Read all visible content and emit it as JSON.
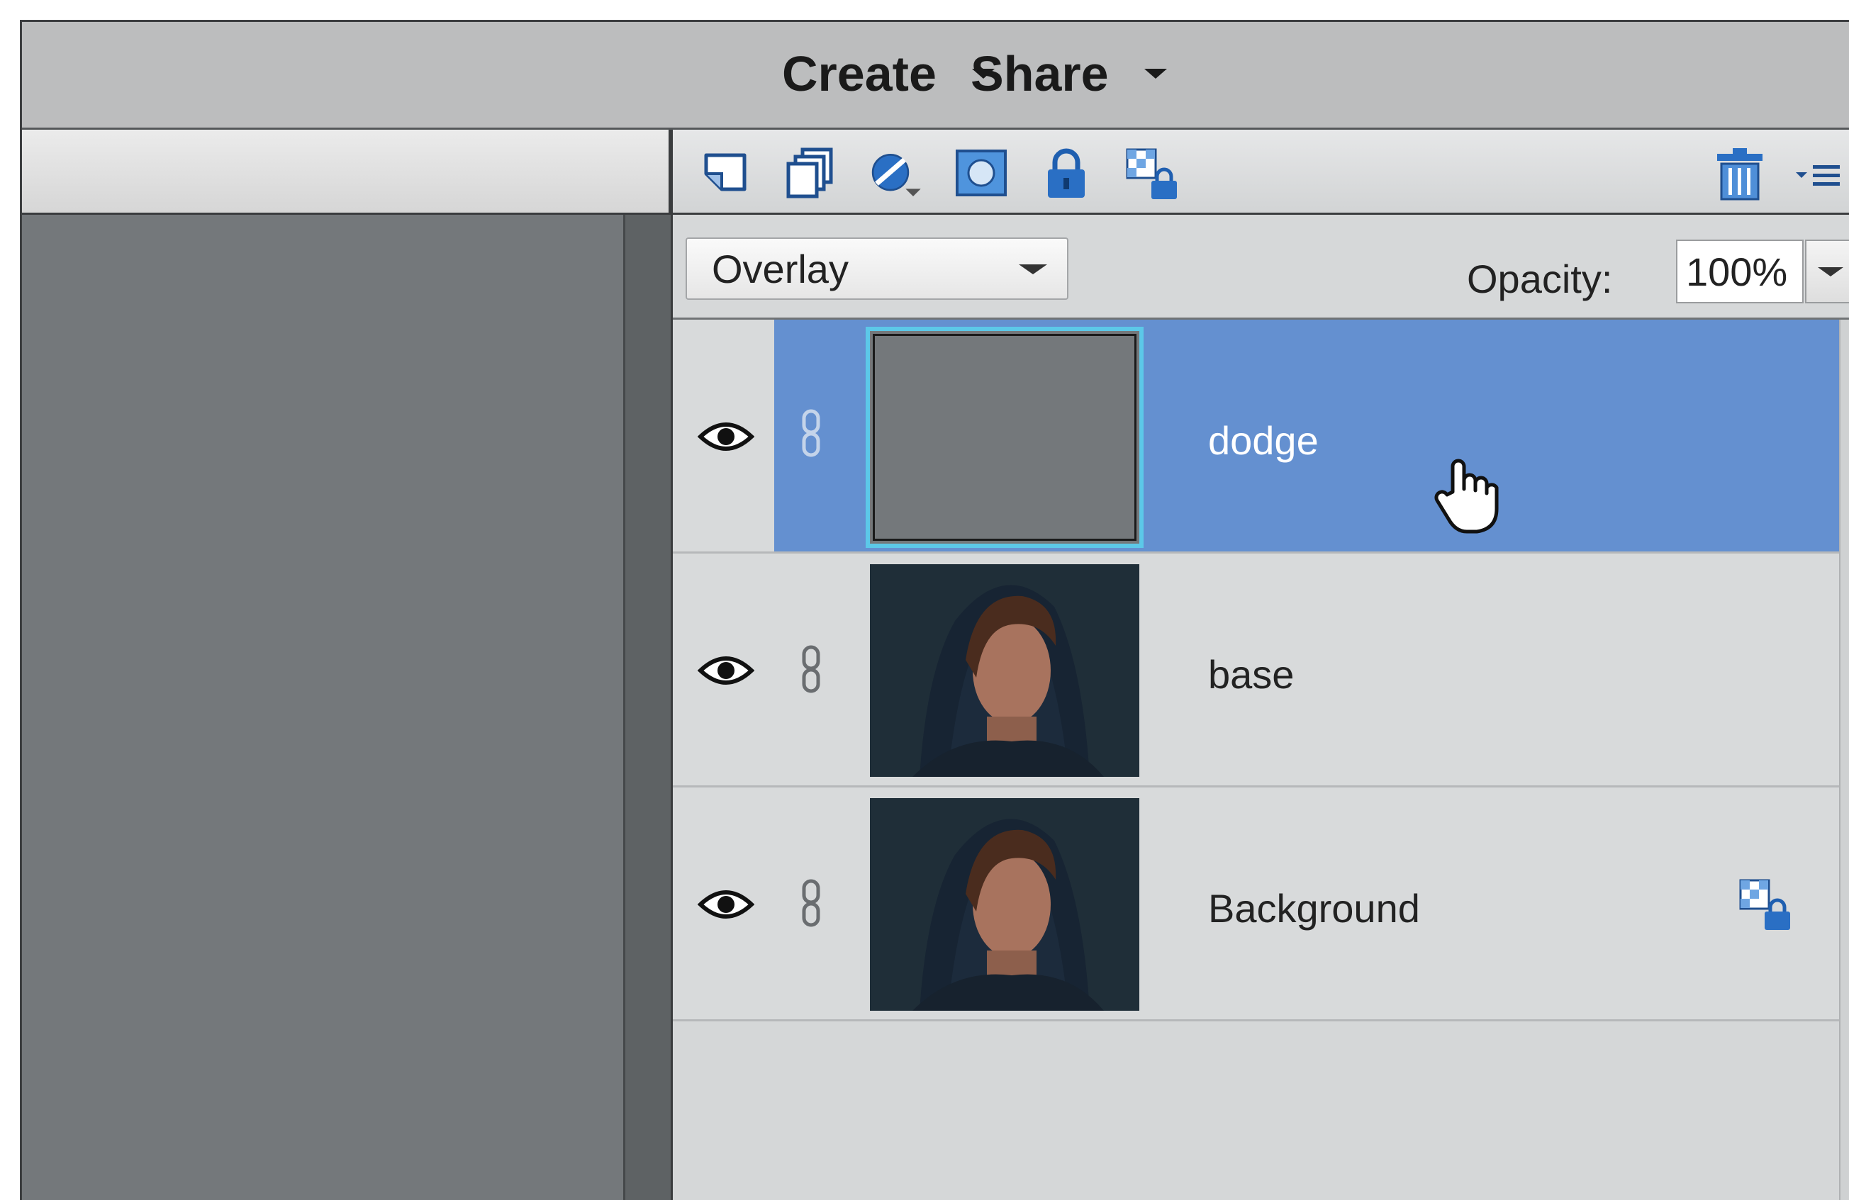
{
  "topbar": {
    "create_label": "Create",
    "share_label": "Share"
  },
  "toolbar": {
    "icons": [
      "new-layer-icon",
      "new-group-icon",
      "adjustment-layer-icon",
      "layer-mask-icon",
      "lock-icon",
      "lock-transparent-pixels-icon",
      "trash-icon",
      "panel-menu-icon"
    ]
  },
  "blend": {
    "mode": "Overlay",
    "opacity_label": "Opacity:",
    "opacity_value": "100%"
  },
  "layers": [
    {
      "name": "dodge",
      "selected": true,
      "visible": true
    },
    {
      "name": "base",
      "selected": false,
      "visible": true
    },
    {
      "name": "Background",
      "selected": false,
      "visible": true,
      "locked": true
    }
  ],
  "colors": {
    "selection": "#6490d0",
    "panel": "#d5d7d8",
    "canvas": "#74787b"
  }
}
